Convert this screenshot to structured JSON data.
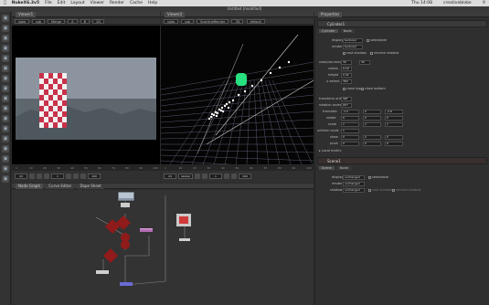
{
  "menubar": {
    "app": "NukeX6.3v5",
    "items": [
      "File",
      "Edit",
      "Layout",
      "Viewer",
      "Render",
      "Cache",
      "Help"
    ],
    "clock": "Thu 14:08",
    "user": "creativeblobe"
  },
  "window": {
    "title": "Untitled [modified]"
  },
  "left_tools": [
    "read-icon",
    "draw-icon",
    "time-icon",
    "channel-icon",
    "color-icon",
    "filter-icon",
    "keyer-icon",
    "merge-icon",
    "transform-icon",
    "3d-icon",
    "views-icon",
    "metadata-icon",
    "toolsets-icon",
    "other-icon",
    "furnace-icon",
    "ocula-icon",
    "particles-icon"
  ],
  "viewer1": {
    "tab": "Viewer1",
    "toolbar": [
      "rgba",
      "rgb",
      "Merge",
      "A",
      "B",
      "2D"
    ],
    "colors": {
      "sky": "#9aa3ad",
      "city": "#5f6a72",
      "checker_red": "#c8324a"
    }
  },
  "viewer2": {
    "tab": "Viewer2",
    "toolbar": [
      "rgba",
      "rgb",
      "ScanlineRender",
      "3D",
      "default"
    ],
    "colors": {
      "grid": "#6f6f8a",
      "object": "#27e07f",
      "points": "#ffffff"
    }
  },
  "timeline1": {
    "frame": "1",
    "end": "100",
    "fps": "24",
    "ticks": [
      "1",
      "10",
      "20",
      "30",
      "40",
      "50",
      "60",
      "70",
      "80",
      "90",
      "100"
    ]
  },
  "timeline2": {
    "frame": "1",
    "end": "100",
    "fps": "24",
    "mode": "Global",
    "ticks": [
      "1",
      "10",
      "20",
      "30",
      "40",
      "50",
      "60",
      "70",
      "80",
      "90",
      "100"
    ]
  },
  "nodegraph": {
    "tabs": [
      "Node Graph",
      "Curve Editor",
      "Dope Sheet"
    ],
    "nodes": [
      {
        "label": "Read1",
        "kind": "read"
      },
      {
        "label": "Camera1",
        "kind": "3d"
      },
      {
        "label": "Scene1",
        "kind": "3d"
      },
      {
        "label": "ScanlineRender1",
        "kind": "render"
      },
      {
        "label": "Viewer1",
        "kind": "viewer"
      },
      {
        "label": "Cylinder1",
        "kind": "geo"
      },
      {
        "label": "Card1",
        "kind": "geo"
      }
    ]
  },
  "properties": {
    "tab": "Properties",
    "node1": {
      "name": "Cylinder1",
      "tabs": [
        "Cylinder",
        "Node"
      ],
      "display": "textured",
      "render": "textured",
      "selectable": "selectable",
      "cast_shadow": "cast shadow",
      "receive_shadow": "receive shadow",
      "rows_columns_label": "rows/columns",
      "rows": "30",
      "columns": "30",
      "radius_label": "radius",
      "radius": "0.18",
      "height_label": "height",
      "height": "0.42",
      "uv_extent_label": "u extent",
      "uv_extent": "360",
      "close_top": "close top",
      "close_bottom": "close bottom",
      "transform_order_label": "transform order",
      "transform_order": "SRT",
      "rotation_order_label": "rotation order",
      "rotation_order": "ZXY",
      "translate_label": "translate",
      "translate": [
        "-1.2",
        "0",
        "-2.6"
      ],
      "rotate_label": "rotate",
      "rotate": [
        "0",
        "0",
        "0"
      ],
      "scale_label": "scale",
      "scale": [
        "1",
        "1",
        "1"
      ],
      "uniform_scale_label": "uniform scale",
      "uniform_scale": "1",
      "skew_label": "skew",
      "skew": [
        "0",
        "0",
        "0"
      ],
      "pivot_label": "pivot",
      "pivot": [
        "0",
        "0",
        "0"
      ],
      "local_matrix": "Local matrix"
    },
    "node2": {
      "name": "Scene1",
      "tabs": [
        "Scene",
        "Node"
      ],
      "display_label": "display",
      "display": "unchanged",
      "render_label": "render",
      "render": "unchanged",
      "shadow_label": "shadow",
      "shadow": "unchanged",
      "selectable": "selectable",
      "cast_shadow": "cast shadow",
      "receive_shadow": "receive shadow"
    }
  }
}
